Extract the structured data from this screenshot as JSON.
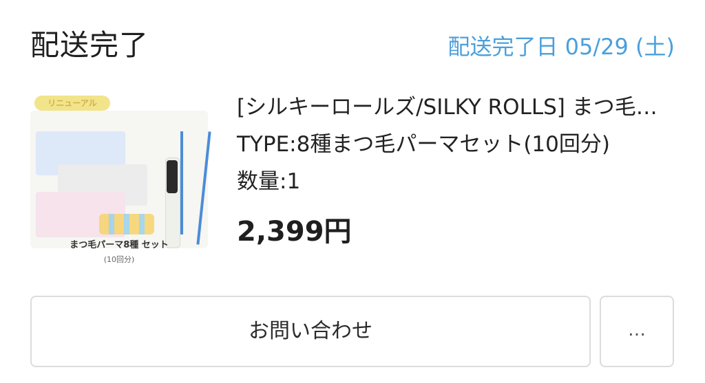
{
  "order": {
    "status": "配送完了",
    "delivery_date": "配送完了日 05/29 (土)"
  },
  "product": {
    "image_icon": "product-image",
    "image_badge": "リニューアル",
    "image_caption": "まつ毛パーマ8種 セット",
    "image_subcaption": "(10回分)",
    "name": "[シルキーロールズ/SILKY ROLLS] まつ毛パーマ…",
    "type": "TYPE:8種まつ毛パーマセット(10回分)",
    "quantity": "数量:1",
    "price": "2,399円"
  },
  "actions": {
    "contact_label": "お問い合わせ",
    "more_label": "…"
  },
  "colors": {
    "accent": "#4a9fdc",
    "border": "#dcdcdc",
    "text": "#222222"
  }
}
